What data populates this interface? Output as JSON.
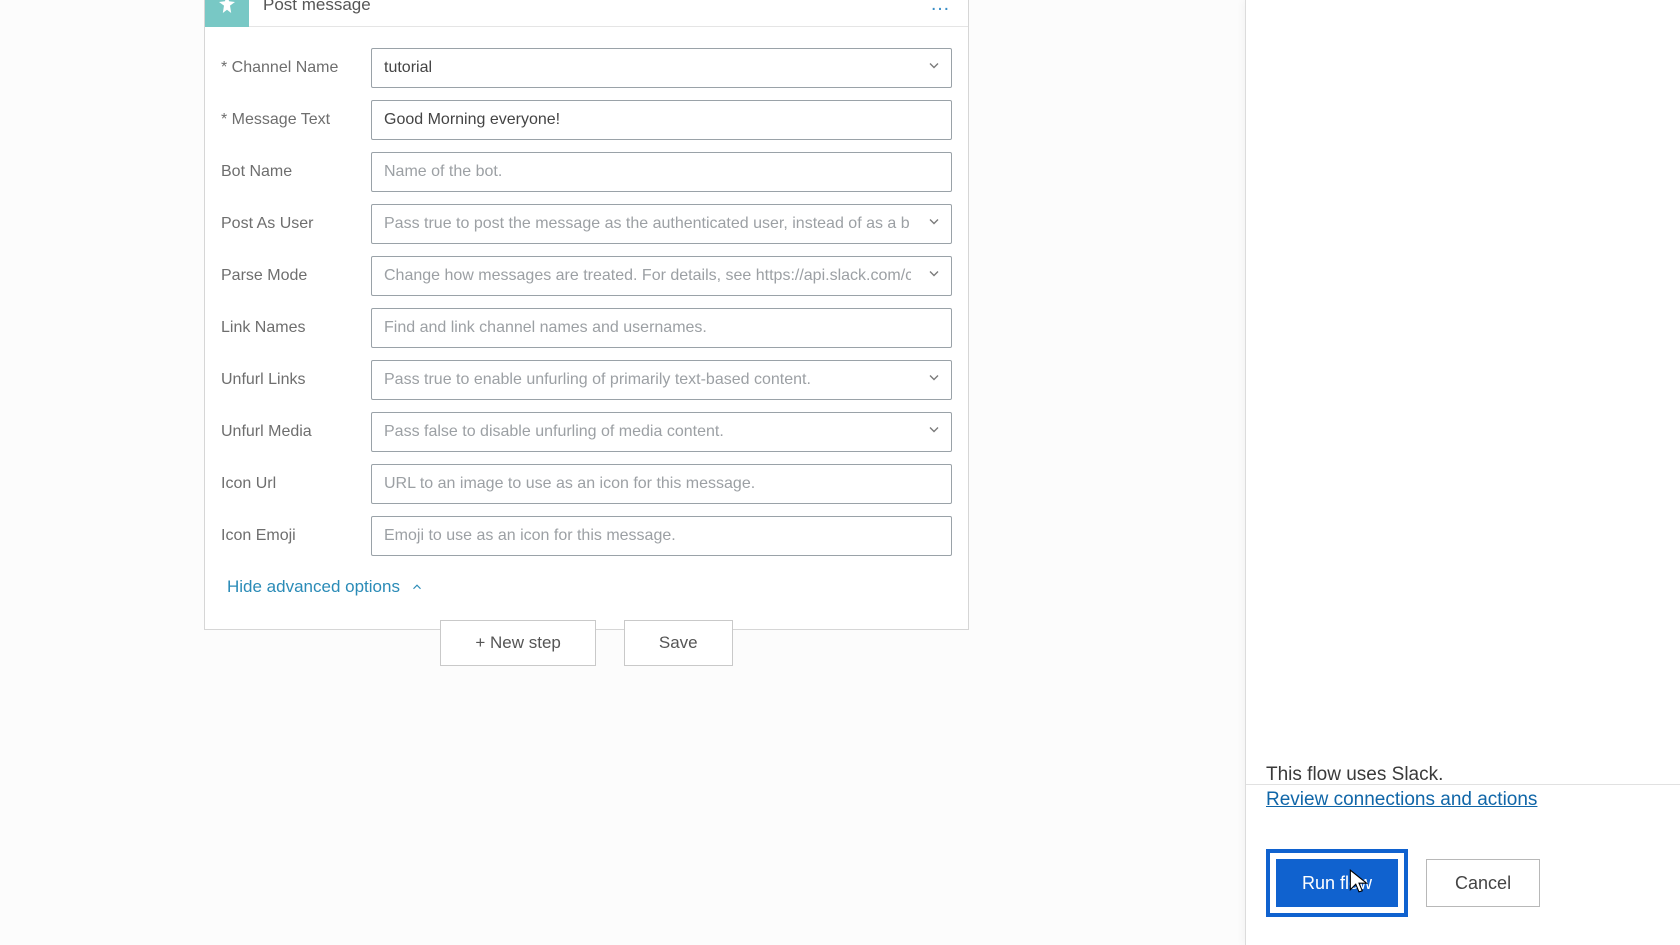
{
  "card": {
    "title": "Post message",
    "menu_icon": "…",
    "hide_advanced": "Hide advanced options"
  },
  "fields": {
    "channel_name": {
      "label": "* Channel Name",
      "value": "tutorial",
      "has_chevron": true
    },
    "message_text": {
      "label": "* Message Text",
      "value": "Good Morning everyone!",
      "has_chevron": false
    },
    "bot_name": {
      "label": "Bot Name",
      "placeholder": "Name of the bot.",
      "has_chevron": false
    },
    "post_as_user": {
      "label": "Post As User",
      "placeholder": "Pass true to post the message as the authenticated user, instead of as a b",
      "has_chevron": true
    },
    "parse_mode": {
      "label": "Parse Mode",
      "placeholder": "Change how messages are treated. For details, see https://api.slack.com/c",
      "has_chevron": true
    },
    "link_names": {
      "label": "Link Names",
      "placeholder": "Find and link channel names and usernames.",
      "has_chevron": false
    },
    "unfurl_links": {
      "label": "Unfurl Links",
      "placeholder": "Pass true to enable unfurling of primarily text-based content.",
      "has_chevron": true
    },
    "unfurl_media": {
      "label": "Unfurl Media",
      "placeholder": "Pass false to disable unfurling of media content.",
      "has_chevron": true
    },
    "icon_url": {
      "label": "Icon Url",
      "placeholder": "URL to an image to use as an icon for this message.",
      "has_chevron": false
    },
    "icon_emoji": {
      "label": "Icon Emoji",
      "placeholder": "Emoji to use as an icon for this message.",
      "has_chevron": false
    }
  },
  "bottom": {
    "new_step": "+  New step",
    "save": "Save"
  },
  "panel": {
    "uses_text": "This flow uses Slack.",
    "review_link": "Review connections and actions",
    "run_flow": "Run flow",
    "cancel": "Cancel"
  }
}
